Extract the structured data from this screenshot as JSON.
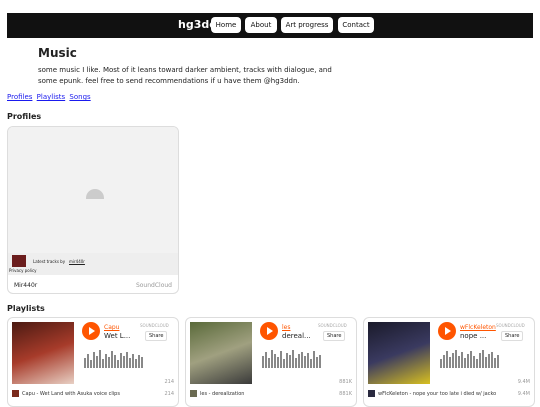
{
  "nav": {
    "brand": "hg3ddn",
    "buttons": [
      "Home",
      "About",
      "Art progress",
      "Contact"
    ]
  },
  "page": {
    "title": "Music",
    "intro": "some music I like. Most of it leans toward darker ambient, tracks with dialogue, and some epunk. feel free to send recommendations if u have them @hg3ddn.",
    "links": [
      "Profiles",
      "Playlists",
      "Songs"
    ]
  },
  "profiles": {
    "heading": "Profiles",
    "card": {
      "latest_prefix": "Latest tracks by ",
      "latest_user": "mir440r",
      "privacy": "Privacy policy",
      "name": "Mir440r",
      "provider": "SoundCloud"
    }
  },
  "playlists": {
    "heading": "Playlists",
    "widget_brand": "SOUNDCLOUD",
    "share_label": "Share",
    "items": [
      {
        "user": "Capu",
        "title": "Wet L...",
        "plays": "214",
        "track": "Capu - Wet Land with Asuka voice clips",
        "track_plays": "214"
      },
      {
        "user": "les",
        "title": "dereal...",
        "plays": "881K",
        "track": "les - derealization",
        "track_plays": "881K"
      },
      {
        "user": "wFlcKeleton",
        "title": "nope ...",
        "plays": "9.4M",
        "track": "wFlcKeleton - nope your too late i died w/ jacko",
        "track_plays": "9.4M"
      }
    ]
  },
  "colors": {
    "accent": "#ff5500",
    "nav_bg": "#111111",
    "link": "#1a1aee"
  }
}
